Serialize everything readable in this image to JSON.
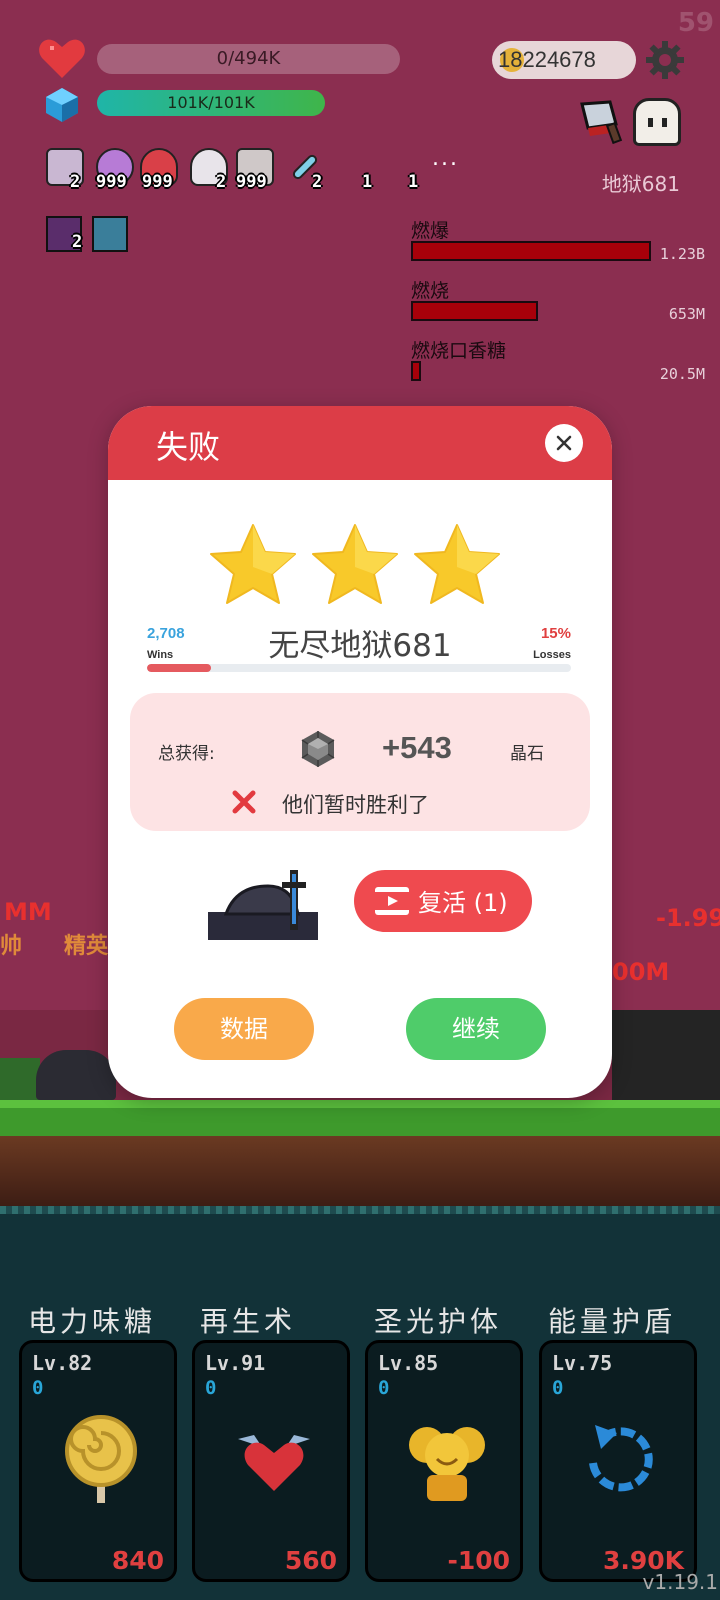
{
  "hud": {
    "fps": "59",
    "hp_text": "0/494K",
    "mana_text": "101K/101K",
    "coins": "18224678",
    "stage_label": "地狱681",
    "buff_counts": [
      "2",
      "999",
      "999",
      "2",
      "999",
      "2",
      "1",
      "1"
    ],
    "buff_extra": "...",
    "buff2_count": "2"
  },
  "dot_effects": [
    {
      "name": "燃爆",
      "value": "1.23B",
      "fraction": 1.0
    },
    {
      "name": "燃烧",
      "value": "653M",
      "fraction": 0.53
    },
    {
      "name": "燃烧口香糖",
      "value": "20.5M",
      "fraction": 0.02
    }
  ],
  "battle_text": {
    "left_damage": "MM",
    "left_tag": "精英",
    "left_prefix": "帅",
    "right_damage": "-1.99",
    "right_damage2": "00M"
  },
  "modal": {
    "title": "失败",
    "stars": 3,
    "wins_count": "2,708",
    "wins_label": "Wins",
    "losses_pct": "15%",
    "losses_label": "Losses",
    "stage_name": "无尽地狱681",
    "progress_fraction": 0.15,
    "reward_label": "总获得:",
    "reward_amount": "+543",
    "reward_unit": "晶石",
    "fail_message": "他们暂时胜利了",
    "revive_label": "复活 (1)",
    "stats_label": "数据",
    "continue_label": "继续"
  },
  "skills": [
    {
      "name": "电力味糖",
      "level": "Lv.82",
      "count": "0",
      "cost": "840",
      "icon": "lollipop-icon"
    },
    {
      "name": "再生术",
      "level": "Lv.91",
      "count": "0",
      "cost": "560",
      "icon": "winged-heart-icon"
    },
    {
      "name": "圣光护体",
      "level": "Lv.85",
      "count": "0",
      "cost": "-100",
      "icon": "golden-idol-icon"
    },
    {
      "name": "能量护盾",
      "level": "Lv.75",
      "count": "0",
      "cost": "3.90K",
      "icon": "refresh-arrow-icon"
    }
  ],
  "version": "v1.19.1",
  "colors": {
    "modal_header": "#dc3d47",
    "stats_button": "#f9a94a",
    "continue_button": "#4fcc6a",
    "revive_button": "#ef4a4f",
    "star": "#f8c92a"
  }
}
